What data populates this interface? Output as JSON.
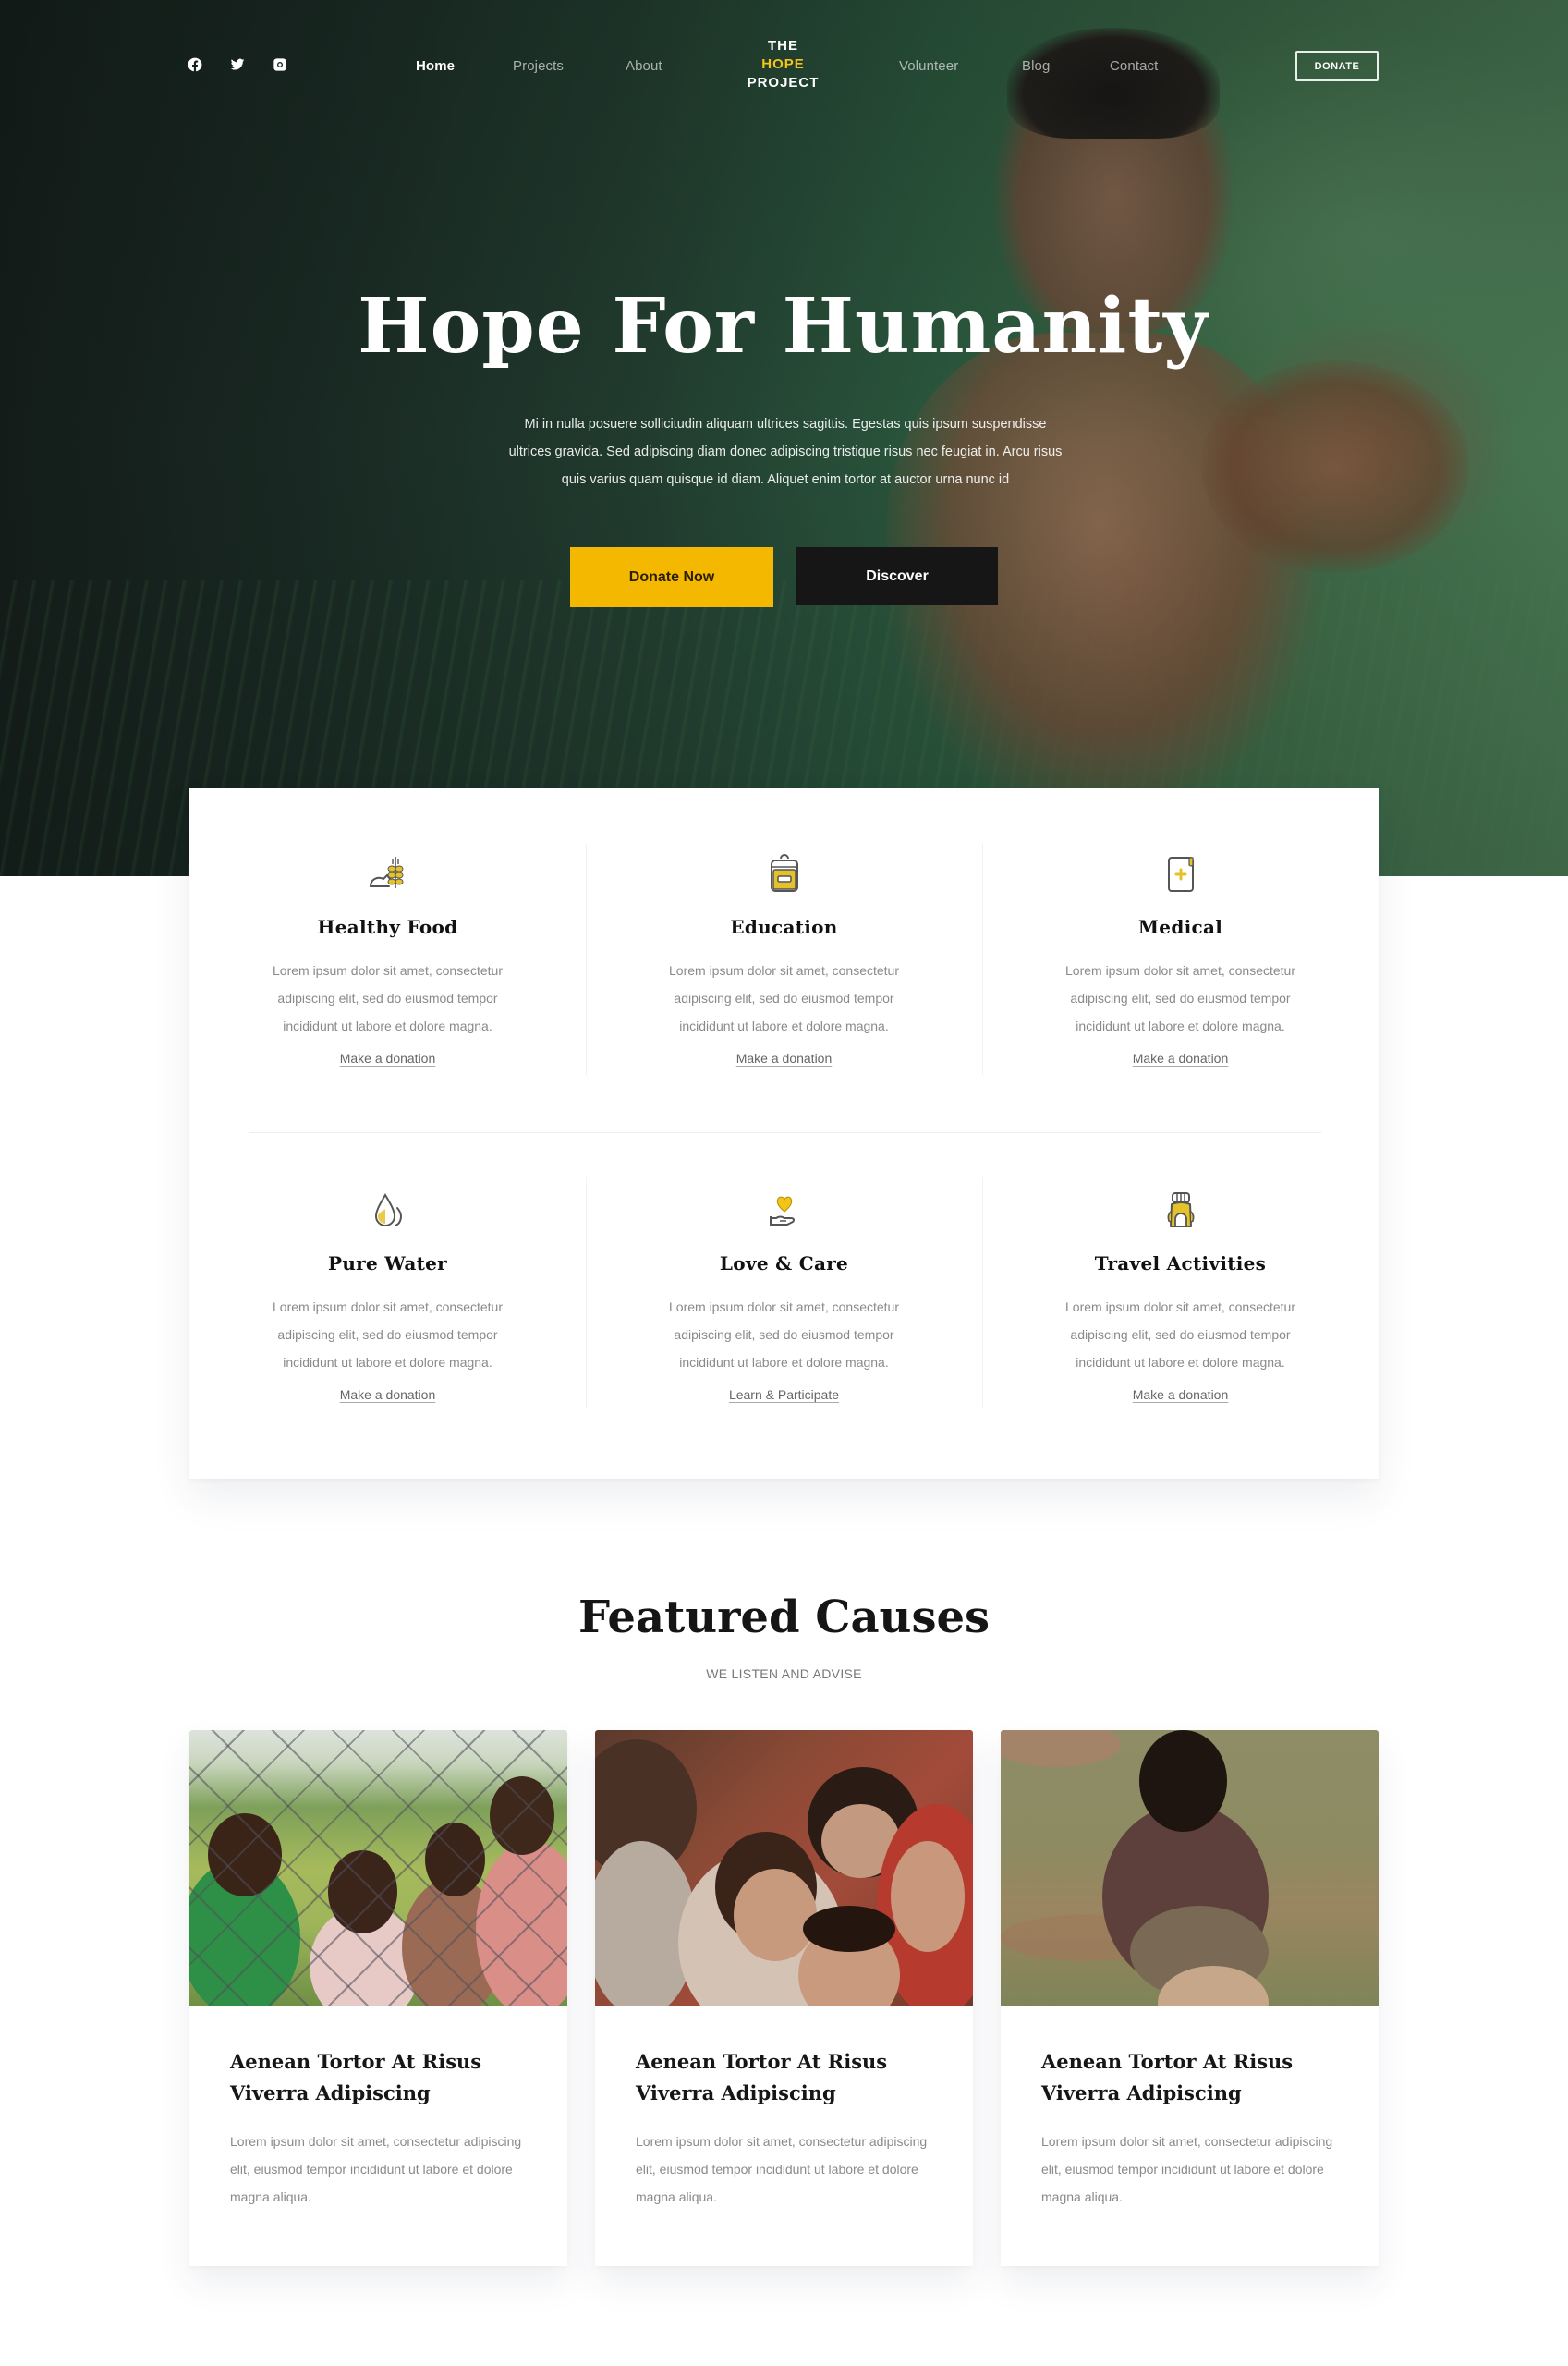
{
  "nav": {
    "social": [
      {
        "icon": "facebook-icon",
        "label": "Facebook"
      },
      {
        "icon": "twitter-icon",
        "label": "Twitter"
      },
      {
        "icon": "instagram-icon",
        "label": "Instagram"
      }
    ],
    "links_left": [
      {
        "label": "Home",
        "active": true
      },
      {
        "label": "Projects",
        "active": false
      },
      {
        "label": "About",
        "active": false
      }
    ],
    "logo": {
      "line1": "THE",
      "line2": "HOPE",
      "line3": "PROJECT"
    },
    "links_right": [
      {
        "label": "Volunteer",
        "active": false
      },
      {
        "label": "Blog",
        "active": false
      },
      {
        "label": "Contact",
        "active": false
      }
    ],
    "donate_label": "DONATE"
  },
  "hero": {
    "title": "Hope For Humanity",
    "description_lines": [
      "Mi in nulla posuere sollicitudin aliquam ultrices sagittis. Egestas quis ipsum suspendisse",
      "ultrices gravida. Sed adipiscing diam donec adipiscing tristique risus nec feugiat in. Arcu risus",
      "quis varius quam quisque id diam. Aliquet enim tortor at auctor urna nunc id"
    ],
    "primary_button": "Donate Now",
    "secondary_button": "Discover"
  },
  "features": [
    {
      "icon": "wheat-bread-icon",
      "title": "Healthy Food",
      "text": "Lorem ipsum dolor sit amet, consectetur adipiscing elit, sed do eiusmod tempor incididunt ut labore et dolore magna.",
      "link": "Make a donation"
    },
    {
      "icon": "backpack-icon",
      "title": "Education",
      "text": "Lorem ipsum dolor sit amet, consectetur adipiscing elit, sed do eiusmod tempor incididunt ut labore et dolore magna.",
      "link": "Make a donation"
    },
    {
      "icon": "medical-document-icon",
      "title": "Medical",
      "text": "Lorem ipsum dolor sit amet, consectetur adipiscing elit, sed do eiusmod tempor incididunt ut labore et dolore magna.",
      "link": "Make a donation"
    },
    {
      "icon": "water-drop-icon",
      "title": "Pure Water",
      "text": "Lorem ipsum dolor sit amet, consectetur adipiscing elit, sed do eiusmod tempor incididunt ut labore et dolore magna.",
      "link": "Make a donation"
    },
    {
      "icon": "heart-hand-icon",
      "title": "Love & Care",
      "text": "Lorem ipsum dolor sit amet, consectetur adipiscing elit, sed do eiusmod tempor incididunt ut labore et dolore magna.",
      "link": "Learn & Participate"
    },
    {
      "icon": "travel-backpack-icon",
      "title": "Travel Activities",
      "text": "Lorem ipsum dolor sit amet, consectetur adipiscing elit, sed do eiusmod tempor incididunt ut labore et dolore magna.",
      "link": "Make a donation"
    }
  ],
  "causes": {
    "title": "Featured Causes",
    "subtitle": "WE LISTEN AND ADVISE",
    "cards": [
      {
        "image": "children-behind-fence-photo",
        "title": "Aenean Tortor At Risus Viverra Adipiscing",
        "text": "Lorem ipsum dolor sit amet, consectetur adipiscing elit, eiusmod tempor incididunt ut labore et dolore magna aliqua."
      },
      {
        "image": "smiling-children-photo",
        "title": "Aenean Tortor At Risus Viverra Adipiscing",
        "text": "Lorem ipsum dolor sit amet, consectetur adipiscing elit, eiusmod tempor incididunt ut labore et dolore magna aliqua."
      },
      {
        "image": "boy-with-ball-photo",
        "title": "Aenean Tortor At Risus Viverra Adipiscing",
        "text": "Lorem ipsum dolor sit amet, consectetur adipiscing elit, eiusmod tempor incididunt ut labore et dolore magna aliqua."
      }
    ]
  },
  "colors": {
    "accent": "#f5b800",
    "logo_accent": "#f5c518",
    "dark_button": "#161616",
    "heading": "#111111",
    "body_text": "#8a8a8a"
  }
}
